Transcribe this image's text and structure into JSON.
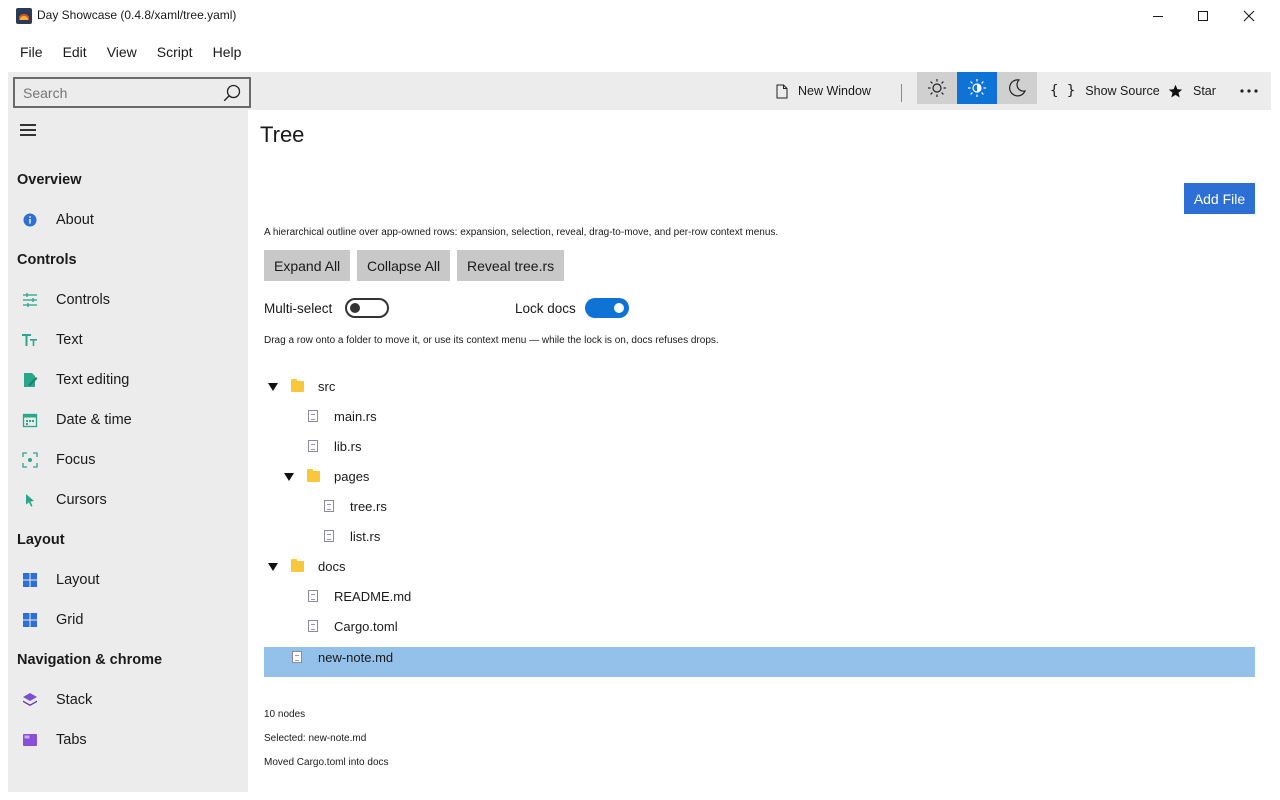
{
  "window": {
    "title": "Day Showcase (0.4.8/xaml/tree.yaml)"
  },
  "menu": [
    "File",
    "Edit",
    "View",
    "Script",
    "Help"
  ],
  "toolbar": {
    "search_placeholder": "Search",
    "new_window_label": "New Window",
    "show_source_label": "Show Source",
    "star_label": "Star",
    "theme": {
      "selected": "auto",
      "options": [
        "light",
        "auto",
        "dark"
      ]
    },
    "accent_color": "#0f73d6"
  },
  "sidebar": {
    "sections": [
      {
        "title": "Overview",
        "items": [
          {
            "label": "About",
            "icon": "info-icon"
          }
        ]
      },
      {
        "title": "Controls",
        "items": [
          {
            "label": "Controls",
            "icon": "sliders-icon"
          },
          {
            "label": "Text",
            "icon": "text-icon"
          },
          {
            "label": "Text editing",
            "icon": "edit-icon"
          },
          {
            "label": "Date & time",
            "icon": "calendar-icon"
          },
          {
            "label": "Focus",
            "icon": "focus-icon"
          },
          {
            "label": "Cursors",
            "icon": "cursor-icon"
          }
        ]
      },
      {
        "title": "Layout",
        "items": [
          {
            "label": "Layout",
            "icon": "layout-icon"
          },
          {
            "label": "Grid",
            "icon": "grid-icon"
          }
        ]
      },
      {
        "title": "Navigation & chrome",
        "items": [
          {
            "label": "Stack",
            "icon": "stack-icon"
          },
          {
            "label": "Tabs",
            "icon": "tabs-icon"
          }
        ]
      }
    ]
  },
  "page": {
    "title": "Tree",
    "add_file_label": "Add File",
    "description": "A hierarchical outline over app-owned rows: expansion, selection, reveal, drag-to-move, and per-row context menus.",
    "buttons": [
      "Expand All",
      "Collapse All",
      "Reveal tree.rs"
    ],
    "multi_select": {
      "label": "Multi-select",
      "on": false
    },
    "lock_docs": {
      "label": "Lock docs",
      "on": true
    },
    "hint": "Drag a row onto a folder to move it, or use its context menu — while the lock is on, docs refuses drops.",
    "tree": [
      {
        "label": "src",
        "type": "folder",
        "depth": 0,
        "expanded": true
      },
      {
        "label": "main.rs",
        "type": "file",
        "depth": 1
      },
      {
        "label": "lib.rs",
        "type": "file",
        "depth": 1
      },
      {
        "label": "pages",
        "type": "folder",
        "depth": 1,
        "expanded": true
      },
      {
        "label": "tree.rs",
        "type": "file",
        "depth": 2
      },
      {
        "label": "list.rs",
        "type": "file",
        "depth": 2
      },
      {
        "label": "docs",
        "type": "folder",
        "depth": 0,
        "expanded": true
      },
      {
        "label": "README.md",
        "type": "file",
        "depth": 1
      },
      {
        "label": "Cargo.toml",
        "type": "file",
        "depth": 1
      },
      {
        "label": "new-note.md",
        "type": "file",
        "depth": 0,
        "selected": true
      }
    ],
    "status": {
      "node_count": "10 nodes",
      "selected": "Selected: new-note.md",
      "last_action": "Moved Cargo.toml into docs"
    }
  }
}
